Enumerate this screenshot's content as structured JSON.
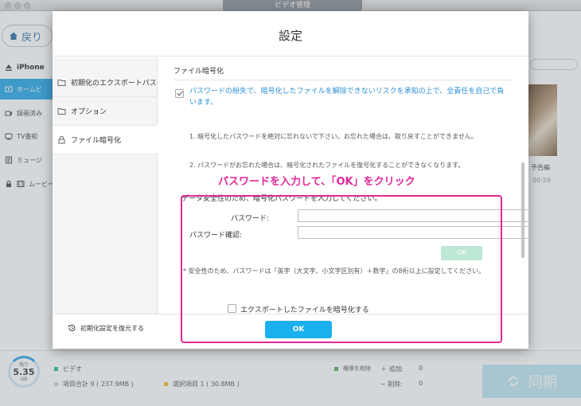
{
  "app": {
    "title": "ビデオ管理",
    "back_label": "戻り",
    "sidebar": [
      {
        "label": "iPhone",
        "icon": "eject-icon"
      },
      {
        "label": "ホームビ",
        "icon": "movie-icon"
      },
      {
        "label": "録画済み",
        "icon": "camera-icon"
      },
      {
        "label": "TV番組",
        "icon": "tv-icon"
      },
      {
        "label": "ミュージ",
        "icon": "music-icon"
      },
      {
        "label": "ムービー",
        "icon": "film-icon"
      }
    ],
    "thumb_label": "予告編",
    "thumb_time": "00:59",
    "storage": {
      "label": "残り",
      "value": "5.35",
      "unit": "GB"
    },
    "bottom": {
      "video_label": "ビデオ",
      "items_total": "項目合計 9 ( 237.9MB )",
      "selected_items": "選択項目 1 ( 30.8MB )",
      "delete_perm": "権限を削除",
      "add_label": "＋ 追加:",
      "add_count": "0",
      "remove_label": "− 削除:",
      "remove_count": "0",
      "sync_label": "同期"
    },
    "colors": {
      "accent": "#22a6e8",
      "highlight": "#e0289a",
      "video_dot": "#25b9a4",
      "selected_dot": "#f3c21b",
      "delete_dot": "#4caf50"
    }
  },
  "dialog": {
    "title": "設定",
    "nav": [
      {
        "label": "初期化のエクスポートパス",
        "icon": "folder-icon"
      },
      {
        "label": "オプション",
        "icon": "folder-icon"
      },
      {
        "label": "ファイル暗号化",
        "icon": "lock-icon"
      }
    ],
    "section_title": "ファイル暗号化",
    "warning": "パスワードの紛失で、暗号化したファイルを解除できないリスクを承知の上で、全責任を自己で負います。",
    "note1": "1. 暗号化したパスワードを絶対に忘れないで下さい。お忘れた場合は、取り戻すことができません。",
    "note2": "2. パスワードがお忘れた場合は、暗号化されたファイルを復号化することができなくなります。",
    "annotation": "パスワードを入力して、「OK」をクリック",
    "instruction": "データ安全性のため、暗号化パスワードを入力してください。",
    "password_label": "パスワード:",
    "password_confirm_label": "パスワード確認:",
    "ok_small": "OK",
    "hint": "* 安全性のため、パスワードは「英字（大文字、小文字区別有）＋数字」の8桁以上に設定してください。",
    "encrypt_export_label": "エクスポートしたファイルを暗号化する",
    "restore_label": "初期化設定を復元する",
    "ok_main": "OK"
  }
}
